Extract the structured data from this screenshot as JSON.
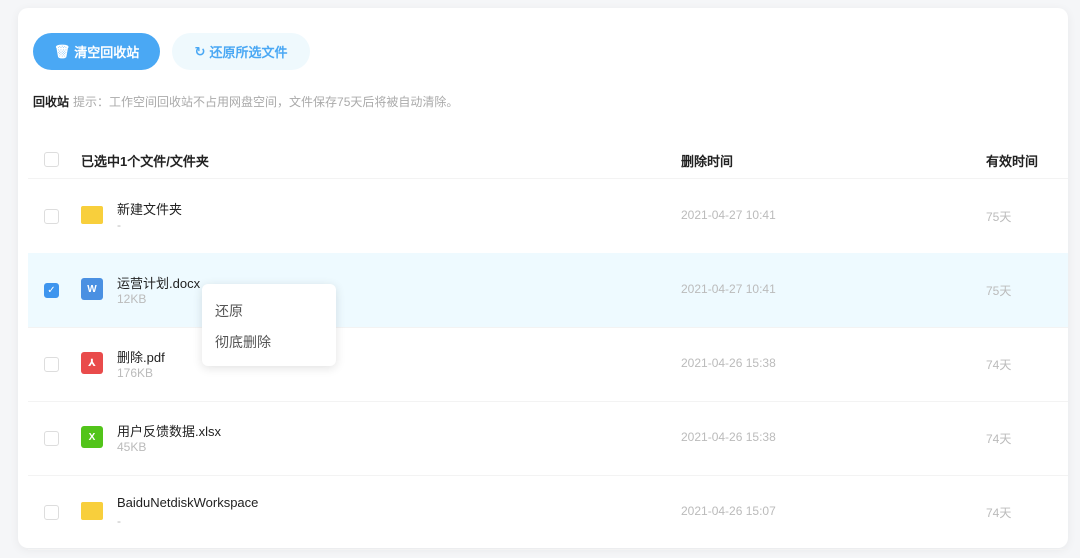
{
  "toolbar": {
    "clear_label": "清空回收站",
    "restore_label": "还原所选文件"
  },
  "hint": {
    "title": "回收站",
    "text": "提示：工作空间回收站不占用网盘空间，文件保存75天后将被自动清除。"
  },
  "table": {
    "headers": {
      "name": "已选中1个文件/文件夹",
      "time": "删除时间",
      "valid": "有效时间"
    },
    "rows": [
      {
        "name": "新建文件夹",
        "size": "-",
        "time": "2021-04-27 10:41",
        "valid": "75天",
        "type": "folder",
        "icon": "folder-icon",
        "selected": false
      },
      {
        "name": "运营计划.docx",
        "size": "12KB",
        "time": "2021-04-27 10:41",
        "valid": "75天",
        "type": "W",
        "icon": "word-icon",
        "selected": true
      },
      {
        "name": "删除.pdf",
        "size": "176KB",
        "time": "2021-04-26 15:38",
        "valid": "74天",
        "type": "pdf",
        "icon": "pdf-icon",
        "selected": false
      },
      {
        "name": "用户反馈数据.xlsx",
        "size": "45KB",
        "time": "2021-04-26 15:38",
        "valid": "74天",
        "type": "X",
        "icon": "excel-icon",
        "selected": false
      },
      {
        "name": "BaiduNetdiskWorkspace",
        "size": "-",
        "time": "2021-04-26 15:07",
        "valid": "74天",
        "type": "folder",
        "icon": "folder-icon",
        "selected": false
      }
    ]
  },
  "context_menu": {
    "items": [
      "还原",
      "彻底删除"
    ]
  },
  "colors": {
    "accent": "#4aa8f4",
    "selected_row": "#eefaff",
    "word": "#4a90e2",
    "pdf": "#e94b4b",
    "excel": "#52c41a",
    "folder": "#f8cf3c"
  }
}
